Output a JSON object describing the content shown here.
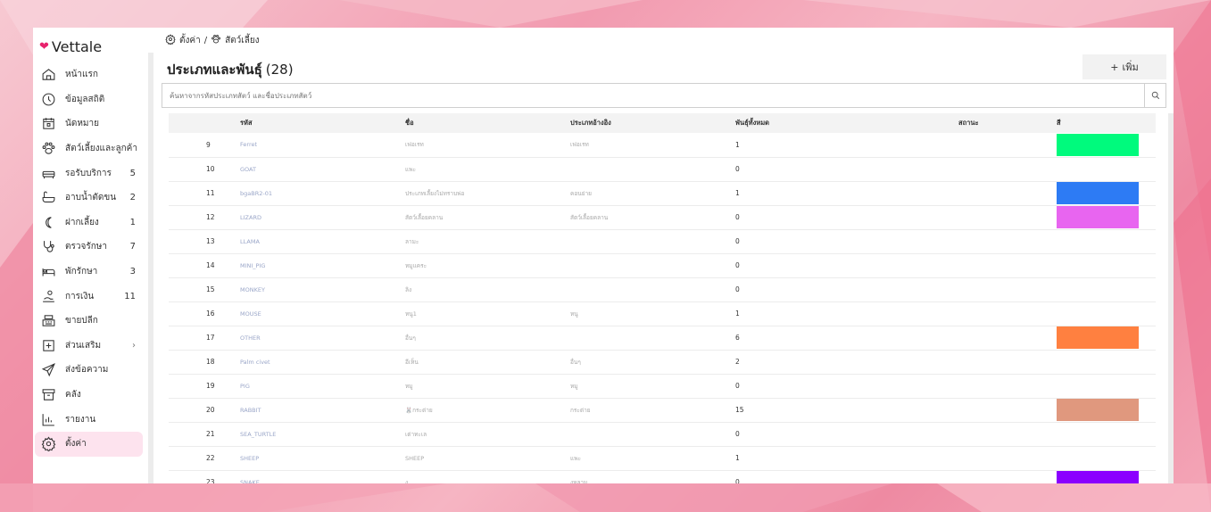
{
  "app": {
    "brand": "Vettale",
    "brand_color": "#e8226d"
  },
  "sidebar": {
    "items": [
      {
        "label": "หน้าแรก",
        "icon": "home-icon",
        "count": ""
      },
      {
        "label": "ข้อมูลสถิติ",
        "icon": "stats-icon",
        "count": ""
      },
      {
        "label": "นัดหมาย",
        "icon": "calendar-icon",
        "count": ""
      },
      {
        "label": "สัตว์เลี้ยงและลูกค้า",
        "icon": "paw-icon",
        "count": ""
      },
      {
        "label": "รอรับบริการ",
        "icon": "sofa-icon",
        "count": "5"
      },
      {
        "label": "อาบน้ำตัดขน",
        "icon": "bathtub-icon",
        "count": "2"
      },
      {
        "label": "ฝากเลี้ยง",
        "icon": "moon-icon",
        "count": "1"
      },
      {
        "label": "ตรวจรักษา",
        "icon": "stethoscope-icon",
        "count": "7"
      },
      {
        "label": "พักรักษา",
        "icon": "bed-icon",
        "count": "3"
      },
      {
        "label": "การเงิน",
        "icon": "money-icon",
        "count": "11"
      },
      {
        "label": "ขายปลีก",
        "icon": "cash-register-icon",
        "count": ""
      },
      {
        "label": "ส่วนเสริม",
        "icon": "plus-square-icon",
        "count": "",
        "chevron": "›"
      },
      {
        "label": "ส่งข้อความ",
        "icon": "send-icon",
        "count": ""
      },
      {
        "label": "คลัง",
        "icon": "archive-icon",
        "count": ""
      },
      {
        "label": "รายงาน",
        "icon": "report-icon",
        "count": ""
      },
      {
        "label": "ตั้งค่า",
        "icon": "gear-icon",
        "count": "",
        "active": true
      }
    ]
  },
  "breadcrumb": {
    "settings": "ตั้งค่า",
    "separator": "/",
    "current": "สัตว์เลี้ยง"
  },
  "header": {
    "title": "ประเภทและพันธุ์",
    "count": "(28)",
    "add_label": "เพิ่ม",
    "add_icon": "+"
  },
  "search": {
    "placeholder": "ค้นหาจากรหัสประเภทสัตว์ และชื่อประเภทสัตว์"
  },
  "table": {
    "columns": [
      "",
      "รหัส",
      "ชื่อ",
      "ประเภทอ้างอิง",
      "พันธุ์ทั้งหมด",
      "สถานะ",
      "สี"
    ],
    "rows": [
      {
        "n": "9",
        "code": "Ferret",
        "name": "เฟอเรท",
        "ref": "เฟอเรท",
        "total": "1",
        "color": "#00fa7d"
      },
      {
        "n": "10",
        "code": "GOAT",
        "name": "แพะ",
        "ref": "",
        "total": "0",
        "color": ""
      },
      {
        "n": "11",
        "code": "bgaBR2-01",
        "name": "ประเภทเลี้ยงไม่ทราบพ่อ",
        "ref": "คอนย่าย",
        "total": "1",
        "color": "#2d7bf4"
      },
      {
        "n": "12",
        "code": "LIZARD",
        "name": "สัตว์เลื้อยคลาน",
        "ref": "สัตว์เลื้อยคลาน",
        "total": "0",
        "color": "#e865f0"
      },
      {
        "n": "13",
        "code": "LLAMA",
        "name": "ลามะ",
        "ref": "",
        "total": "0",
        "color": ""
      },
      {
        "n": "14",
        "code": "MINI_PIG",
        "name": "หมูแคระ",
        "ref": "",
        "total": "0",
        "color": ""
      },
      {
        "n": "15",
        "code": "MONKEY",
        "name": "ลิง",
        "ref": "",
        "total": "0",
        "color": ""
      },
      {
        "n": "16",
        "code": "MOUSE",
        "name": "หนู1",
        "ref": "หนู",
        "total": "1",
        "color": ""
      },
      {
        "n": "17",
        "code": "OTHER",
        "name": "อื่นๆ",
        "ref": "",
        "total": "6",
        "color": "#ff8040"
      },
      {
        "n": "18",
        "code": "Palm civet",
        "name": "อีเห็น",
        "ref": "อื่นๆ",
        "total": "2",
        "color": ""
      },
      {
        "n": "19",
        "code": "PIG",
        "name": "หมู",
        "ref": "หมู",
        "total": "0",
        "color": ""
      },
      {
        "n": "20",
        "code": "RABBIT",
        "name": "🐰กระต่าย",
        "ref": "กระต่าย",
        "total": "15",
        "color": "#e0987e"
      },
      {
        "n": "21",
        "code": "SEA_TURTLE",
        "name": "เต่าทะเล",
        "ref": "",
        "total": "0",
        "color": ""
      },
      {
        "n": "22",
        "code": "SHEEP",
        "name": "SHEEP",
        "ref": "แพะ",
        "total": "1",
        "color": ""
      },
      {
        "n": "23",
        "code": "SNAKE",
        "name": "งู",
        "ref": "งูหลาม",
        "total": "0",
        "color": "#8b00ff"
      }
    ]
  }
}
